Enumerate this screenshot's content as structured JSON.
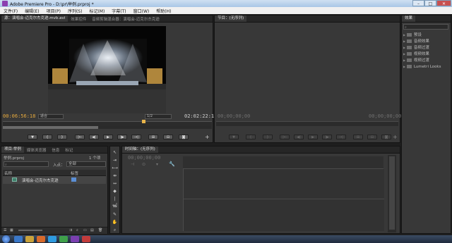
{
  "app": {
    "title": "Adobe Premiere Pro - D:\\pr\\举例.prproj *"
  },
  "window_buttons": {
    "min": "–",
    "max": "□",
    "close": "✕"
  },
  "menu": [
    "文件(F)",
    "编辑(E)",
    "项目(P)",
    "序列(S)",
    "标记(M)",
    "字幕(T)",
    "窗口(W)",
    "帮助(H)"
  ],
  "source_panel": {
    "tabs": [
      "源：演唱会-迈克尔杰克逊.mvb.avi",
      "效果控件",
      "音频剪辑混合器：演唱会-迈克尔杰克逊"
    ],
    "timecode_in": "00:06:56:18",
    "fit": "适合",
    "scale": "1/2",
    "timecode_out": "02:02:22:11"
  },
  "program_panel": {
    "tab": "节目：(无序列)",
    "timecode_in": "00;00;00;00",
    "timecode_out": "00;00;00;00"
  },
  "effects_panel": {
    "tab": "效果",
    "items": [
      "预设",
      "音频效果",
      "音频过渡",
      "视频效果",
      "视频过渡",
      "Lumetri Looks"
    ]
  },
  "project_panel": {
    "tabs": [
      "项目:举例",
      "媒体浏览器",
      "信息",
      "标记"
    ],
    "file": "举例.prproj",
    "count": "1 个项",
    "in_label": "入点：",
    "in_value": "全部",
    "col_name": "名称",
    "col_label": "标签",
    "item_name": "演唱会-迈克尔杰克逊",
    "label_color": "#5b8fd6"
  },
  "timeline_panel": {
    "tab": "时间轴：(无序列)",
    "timecode": "00;00;00;00"
  },
  "colors": {
    "timecode": "#e6a93d",
    "playhead": "#e8b44a",
    "accent": "#5b8fd6"
  }
}
